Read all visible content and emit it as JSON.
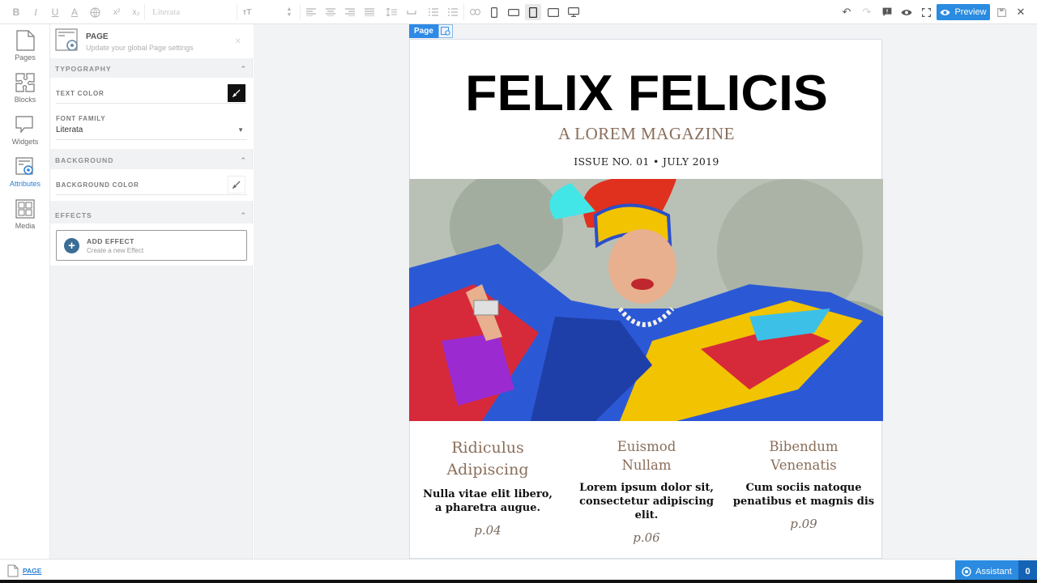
{
  "toolbar": {
    "font_family": "Literata",
    "preview_label": "Preview"
  },
  "rail": [
    {
      "label": "Pages",
      "icon": "pages-icon"
    },
    {
      "label": "Blocks",
      "icon": "blocks-icon"
    },
    {
      "label": "Widgets",
      "icon": "widgets-icon"
    },
    {
      "label": "Attributes",
      "icon": "attributes-icon"
    },
    {
      "label": "Media",
      "icon": "media-icon"
    }
  ],
  "panel": {
    "title": "PAGE",
    "subtitle": "Update your global Page settings",
    "typography": {
      "heading": "TYPOGRAPHY",
      "text_color_label": "TEXT COLOR",
      "text_color": "#000000",
      "font_family_label": "FONT FAMILY",
      "font_family_value": "Literata"
    },
    "background": {
      "heading": "BACKGROUND",
      "bg_color_label": "BACKGROUND COLOR"
    },
    "effects": {
      "heading": "EFFECTS",
      "add_title": "ADD EFFECT",
      "add_sub": "Create a new Effect"
    }
  },
  "canvas": {
    "page_tag": "Page",
    "magazine": {
      "title": "FELIX FELICIS",
      "subtitle": "A LOREM MAGAZINE",
      "issue": "ISSUE NO. 01 • JULY 2019"
    },
    "columns": [
      {
        "title_1": "Ridiculus",
        "title_2": "Adipiscing",
        "text_1": "Nulla vitae elit libero,",
        "text_2": "a pharetra augue.",
        "text_3": "",
        "page": "p.04"
      },
      {
        "title_1": "Euismod",
        "title_2": "Nullam",
        "text_1": "Lorem ipsum dolor sit,",
        "text_2": "consectetur adipiscing",
        "text_3": "elit.",
        "page": "p.06"
      },
      {
        "title_1": "Bibendum",
        "title_2": "Venenatis",
        "text_1": "Cum sociis natoque",
        "text_2": "penatibus et magnis dis",
        "text_3": "",
        "page": "p.09"
      }
    ]
  },
  "bottom": {
    "breadcrumb": "PAGE",
    "assistant_label": "Assistant",
    "assistant_count": "0"
  },
  "colors": {
    "accent": "#2a8be0",
    "magazine_accent": "#8a6e5a"
  }
}
